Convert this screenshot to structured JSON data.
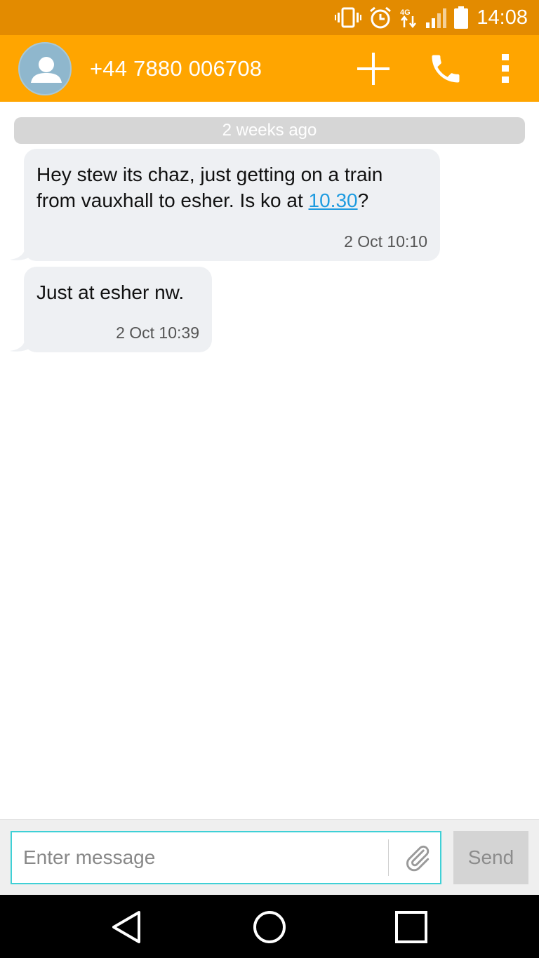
{
  "status_bar": {
    "time": "14:08",
    "network_label": "4G",
    "icons": [
      "vibrate-icon",
      "alarm-icon",
      "network-4g-icon",
      "signal-icon",
      "battery-icon"
    ]
  },
  "app_bar": {
    "contact": "+44 7880 006708",
    "icons": [
      "avatar-placeholder-icon",
      "add-icon",
      "call-icon",
      "more-vert-icon"
    ],
    "colors": {
      "status_bar": "#e38b00",
      "app_bar": "#ffa500"
    }
  },
  "conversation": {
    "divider": "2 weeks ago",
    "messages": [
      {
        "text_before_link": "Hey stew its chaz, just getting on a train from vauxhall to esher. Is ko at ",
        "link": "10.30",
        "text_after_link": "?",
        "time": "2 Oct 10:10"
      },
      {
        "text": "Just at esher nw.",
        "time": "2 Oct 10:39"
      }
    ]
  },
  "compose": {
    "placeholder": "Enter message",
    "value": "",
    "send_label": "Send",
    "accent": "#3fd0d6"
  },
  "nav_bar": {
    "icons": [
      "back-icon",
      "home-icon",
      "recents-icon"
    ]
  }
}
